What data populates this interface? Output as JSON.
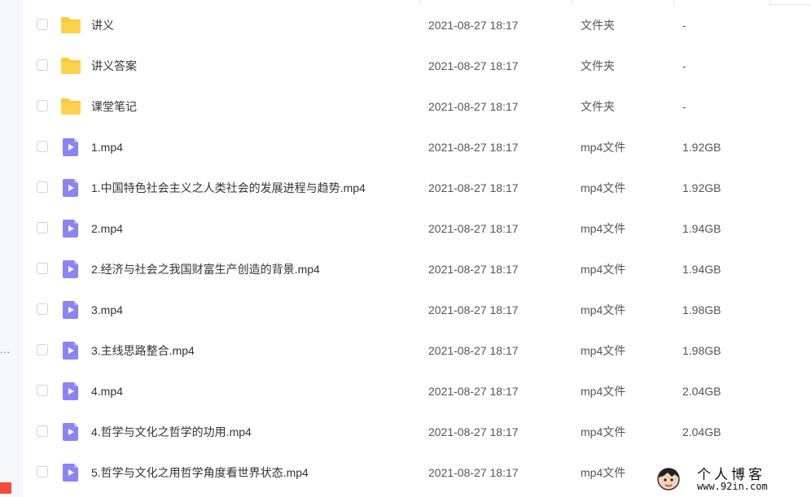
{
  "left_panel": {
    "overflow_text": "..."
  },
  "colors": {
    "folder": "#ffc935",
    "video_icon": "#8b84f4",
    "checkbox_border": "#d0d3d8"
  },
  "files": [
    {
      "name": "讲义",
      "date": "2021-08-27 18:17",
      "type": "文件夹",
      "size": "-",
      "icon": "folder-icon"
    },
    {
      "name": "讲义答案",
      "date": "2021-08-27 18:17",
      "type": "文件夹",
      "size": "-",
      "icon": "folder-icon"
    },
    {
      "name": "课堂笔记",
      "date": "2021-08-27 18:17",
      "type": "文件夹",
      "size": "-",
      "icon": "folder-icon"
    },
    {
      "name": "1.mp4",
      "date": "2021-08-27 18:17",
      "type": "mp4文件",
      "size": "1.92GB",
      "icon": "video-file-icon"
    },
    {
      "name": "1.中国特色社会主义之人类社会的发展进程与趋势.mp4",
      "date": "2021-08-27 18:17",
      "type": "mp4文件",
      "size": "1.92GB",
      "icon": "video-file-icon"
    },
    {
      "name": "2.mp4",
      "date": "2021-08-27 18:17",
      "type": "mp4文件",
      "size": "1.94GB",
      "icon": "video-file-icon"
    },
    {
      "name": "2.经济与社会之我国财富生产创造的背景.mp4",
      "date": "2021-08-27 18:17",
      "type": "mp4文件",
      "size": "1.94GB",
      "icon": "video-file-icon"
    },
    {
      "name": "3.mp4",
      "date": "2021-08-27 18:17",
      "type": "mp4文件",
      "size": "1.98GB",
      "icon": "video-file-icon"
    },
    {
      "name": "3.主线思路整合.mp4",
      "date": "2021-08-27 18:17",
      "type": "mp4文件",
      "size": "1.98GB",
      "icon": "video-file-icon"
    },
    {
      "name": "4.mp4",
      "date": "2021-08-27 18:17",
      "type": "mp4文件",
      "size": "2.04GB",
      "icon": "video-file-icon"
    },
    {
      "name": "4.哲学与文化之哲学的功用.mp4",
      "date": "2021-08-27 18:17",
      "type": "mp4文件",
      "size": "2.04GB",
      "icon": "video-file-icon"
    },
    {
      "name": "5.哲学与文化之用哲学角度看世界状态.mp4",
      "date": "2021-08-27 18:17",
      "type": "mp4文件",
      "size": "",
      "icon": "video-file-icon"
    }
  ],
  "watermark": {
    "title": "个人博客",
    "url": "www.92in.com"
  }
}
